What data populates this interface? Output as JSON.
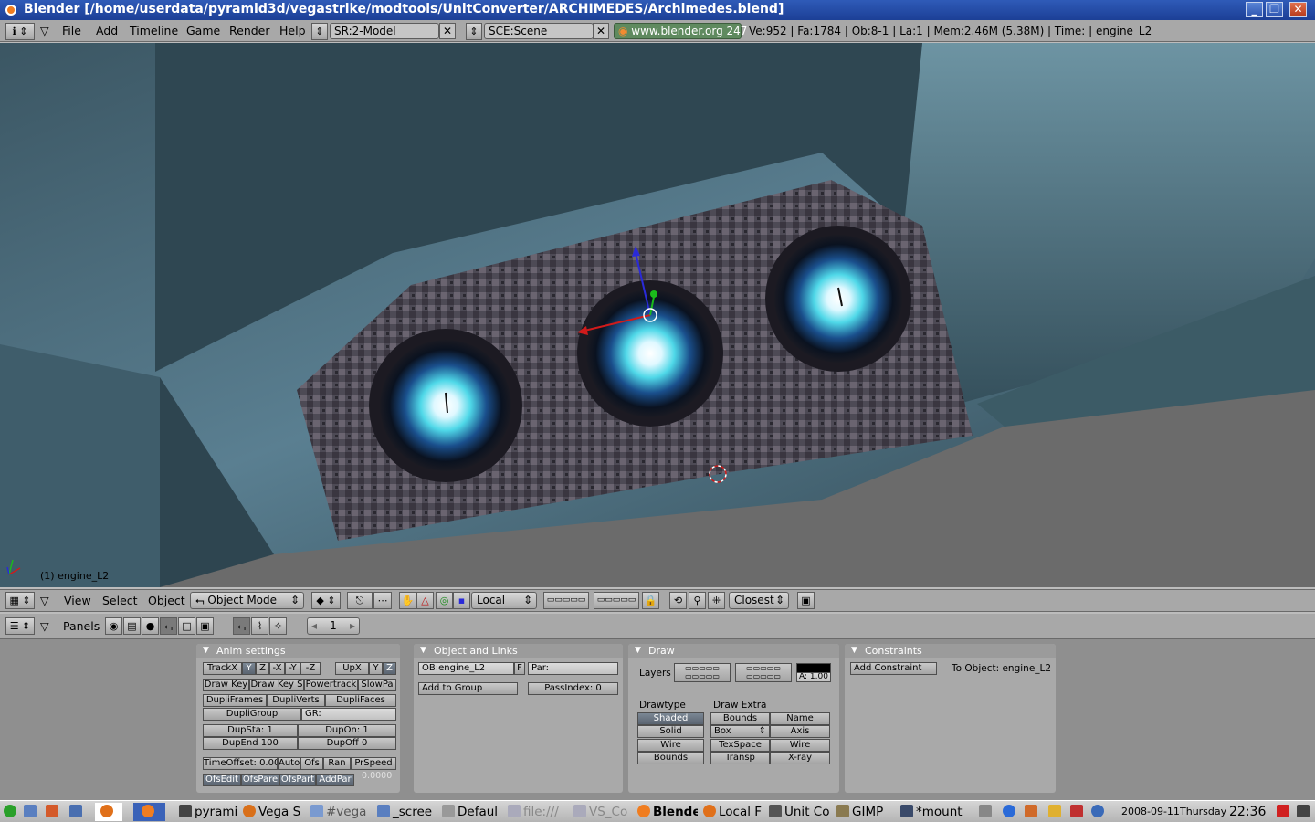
{
  "window": {
    "title": "Blender [/home/userdata/pyramid3d/vegastrike/modtools/UnitConverter/ARCHIMEDES/Archimedes.blend]",
    "controls": [
      "_",
      "❐",
      "✕"
    ]
  },
  "menubar": {
    "items": [
      "File",
      "Add",
      "Timeline",
      "Game",
      "Render",
      "Help"
    ],
    "screen": "SR:2-Model",
    "scene": "SCE:Scene",
    "website": "www.blender.org 247",
    "stats": "Ve:952 | Fa:1784 | Ob:8-1 | La:1  | Mem:2.46M (5.38M)  | Time: | engine_L2"
  },
  "viewport": {
    "object_label": "(1) engine_L2"
  },
  "view3d_header": {
    "menus": [
      "View",
      "Select",
      "Object"
    ],
    "mode": "Object Mode",
    "orientation": "Local",
    "snap": "Closest"
  },
  "buttons_header": {
    "panels_label": "Panels",
    "frame": "1"
  },
  "anim_panel": {
    "title": "Anim settings",
    "track": [
      "TrackX",
      "Y",
      "Z",
      "-X",
      "-Y",
      "-Z"
    ],
    "up": [
      "UpX",
      "Y",
      "Z"
    ],
    "keys": [
      "Draw Key",
      "Draw Key S",
      "Powertrack",
      "SlowPa"
    ],
    "dupli": [
      "DupliFrames",
      "DupliVerts",
      "DupliFaces"
    ],
    "dupligroup": "DupliGroup",
    "gr": "GR:",
    "dupsta": "DupSta: 1",
    "dupon": "DupOn: 1",
    "dupend": "DupEnd 100",
    "dupoff": "DupOff 0",
    "timeoffset": [
      "TimeOffset: 0.00",
      "Auto",
      "Ofs",
      "Ran",
      "PrSpeed"
    ],
    "ofs": [
      "OfsEdit",
      "OfsPare",
      "OfsPart",
      "AddPar"
    ],
    "ofs_value": "0.0000"
  },
  "links_panel": {
    "title": "Object and Links",
    "ob_name": "OB:engine_L2",
    "f_button": "F",
    "par": "Par:",
    "add_group": "Add to Group",
    "passindex": "PassIndex: 0"
  },
  "draw_panel": {
    "title": "Draw",
    "layers_label": "Layers",
    "alpha": "A: 1.00",
    "drawtype_label": "Drawtype",
    "drawtypes": [
      "Shaded",
      "Solid",
      "Wire",
      "Bounds"
    ],
    "extra_label": "Draw Extra",
    "extra": [
      "Bounds",
      "Name",
      "Box",
      "Axis",
      "TexSpace",
      "Wire",
      "Transp",
      "X-ray"
    ]
  },
  "constraints_panel": {
    "title": "Constraints",
    "add": "Add Constraint",
    "target": "To Object: engine_L2"
  },
  "taskbar": {
    "tasks": [
      "pyrami",
      "Vega S",
      "#vega",
      "_scree",
      "Defaul",
      "file:///",
      "VS_Co",
      "Blende",
      "Local F",
      "Unit Co",
      "GIMP",
      "*mount"
    ],
    "date": "2008-09-11",
    "day": "Thursday",
    "time": "22:36"
  },
  "colors": {
    "ui_gray": "#a8a8a8",
    "title_blue": "#2f5bb8",
    "hull": "#4d6f80",
    "engine_glow": "#4fd8e8"
  }
}
